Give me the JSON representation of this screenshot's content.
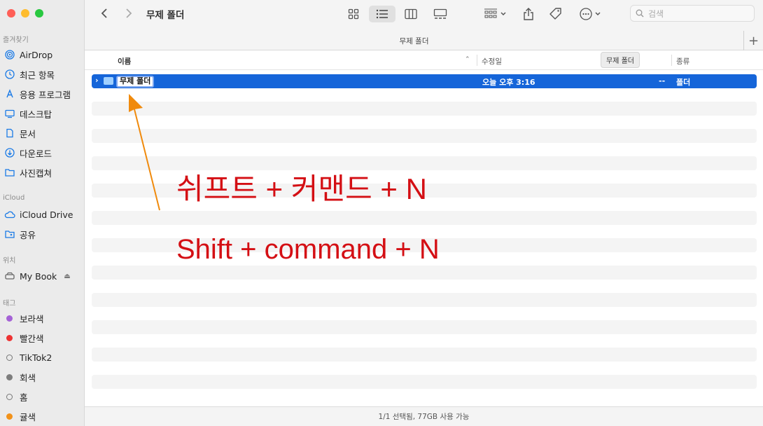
{
  "window": {
    "title": "무제 폴더",
    "tab_label": "무제 폴더"
  },
  "search": {
    "placeholder": "검색"
  },
  "sidebar": {
    "favorites_title": "즐겨찾기",
    "favorites": [
      {
        "label": "AirDrop",
        "icon": "airdrop-icon"
      },
      {
        "label": "최근 항목",
        "icon": "clock-icon"
      },
      {
        "label": "응용 프로그램",
        "icon": "applications-icon"
      },
      {
        "label": "데스크탑",
        "icon": "desktop-icon"
      },
      {
        "label": "문서",
        "icon": "document-icon"
      },
      {
        "label": "다운로드",
        "icon": "download-icon"
      },
      {
        "label": "사진캡쳐",
        "icon": "folder-icon"
      }
    ],
    "icloud_title": "iCloud",
    "icloud": [
      {
        "label": "iCloud Drive",
        "icon": "cloud-icon"
      },
      {
        "label": "공유",
        "icon": "shared-folder-icon"
      }
    ],
    "locations_title": "위치",
    "locations": [
      {
        "label": "My Book",
        "icon": "drive-icon"
      }
    ],
    "tags_title": "태그",
    "tags": [
      {
        "label": "보라색",
        "color": "#a562d6"
      },
      {
        "label": "빨간색",
        "color": "#ee3333"
      },
      {
        "label": "TikTok2",
        "color": ""
      },
      {
        "label": "회색",
        "color": "#7d7d7d"
      },
      {
        "label": "홈",
        "color": ""
      },
      {
        "label": "귤색",
        "color": "#f2921a"
      }
    ]
  },
  "columns": {
    "name": "이름",
    "date": "수정일",
    "kind": "종류"
  },
  "tooltip": "무제 폴더",
  "files": [
    {
      "name": "무제 폴더",
      "date": "오늘 오후 3:16",
      "size": "--",
      "kind": "폴더",
      "selected": true
    }
  ],
  "annotation": {
    "korean": "쉬프트 + 커맨드 + N",
    "english": "Shift + command + N",
    "color": "#d40f14"
  },
  "status": "1/1 선택됨, 77GB 사용 가능"
}
